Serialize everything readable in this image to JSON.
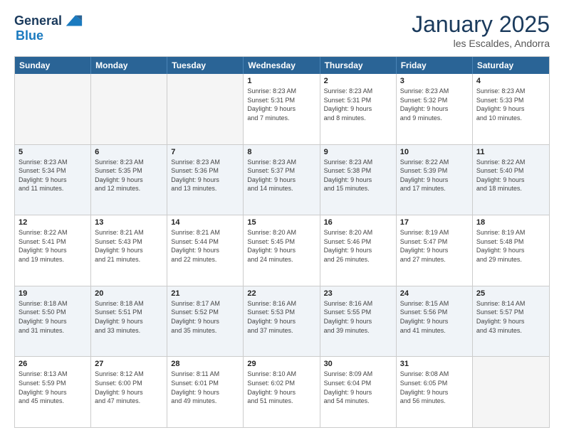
{
  "header": {
    "logo_line1": "General",
    "logo_line2": "Blue",
    "title": "January 2025",
    "subtitle": "les Escaldes, Andorra"
  },
  "weekdays": [
    "Sunday",
    "Monday",
    "Tuesday",
    "Wednesday",
    "Thursday",
    "Friday",
    "Saturday"
  ],
  "rows": [
    [
      {
        "day": "",
        "text": ""
      },
      {
        "day": "",
        "text": ""
      },
      {
        "day": "",
        "text": ""
      },
      {
        "day": "1",
        "text": "Sunrise: 8:23 AM\nSunset: 5:31 PM\nDaylight: 9 hours\nand 7 minutes."
      },
      {
        "day": "2",
        "text": "Sunrise: 8:23 AM\nSunset: 5:31 PM\nDaylight: 9 hours\nand 8 minutes."
      },
      {
        "day": "3",
        "text": "Sunrise: 8:23 AM\nSunset: 5:32 PM\nDaylight: 9 hours\nand 9 minutes."
      },
      {
        "day": "4",
        "text": "Sunrise: 8:23 AM\nSunset: 5:33 PM\nDaylight: 9 hours\nand 10 minutes."
      }
    ],
    [
      {
        "day": "5",
        "text": "Sunrise: 8:23 AM\nSunset: 5:34 PM\nDaylight: 9 hours\nand 11 minutes."
      },
      {
        "day": "6",
        "text": "Sunrise: 8:23 AM\nSunset: 5:35 PM\nDaylight: 9 hours\nand 12 minutes."
      },
      {
        "day": "7",
        "text": "Sunrise: 8:23 AM\nSunset: 5:36 PM\nDaylight: 9 hours\nand 13 minutes."
      },
      {
        "day": "8",
        "text": "Sunrise: 8:23 AM\nSunset: 5:37 PM\nDaylight: 9 hours\nand 14 minutes."
      },
      {
        "day": "9",
        "text": "Sunrise: 8:23 AM\nSunset: 5:38 PM\nDaylight: 9 hours\nand 15 minutes."
      },
      {
        "day": "10",
        "text": "Sunrise: 8:22 AM\nSunset: 5:39 PM\nDaylight: 9 hours\nand 17 minutes."
      },
      {
        "day": "11",
        "text": "Sunrise: 8:22 AM\nSunset: 5:40 PM\nDaylight: 9 hours\nand 18 minutes."
      }
    ],
    [
      {
        "day": "12",
        "text": "Sunrise: 8:22 AM\nSunset: 5:41 PM\nDaylight: 9 hours\nand 19 minutes."
      },
      {
        "day": "13",
        "text": "Sunrise: 8:21 AM\nSunset: 5:43 PM\nDaylight: 9 hours\nand 21 minutes."
      },
      {
        "day": "14",
        "text": "Sunrise: 8:21 AM\nSunset: 5:44 PM\nDaylight: 9 hours\nand 22 minutes."
      },
      {
        "day": "15",
        "text": "Sunrise: 8:20 AM\nSunset: 5:45 PM\nDaylight: 9 hours\nand 24 minutes."
      },
      {
        "day": "16",
        "text": "Sunrise: 8:20 AM\nSunset: 5:46 PM\nDaylight: 9 hours\nand 26 minutes."
      },
      {
        "day": "17",
        "text": "Sunrise: 8:19 AM\nSunset: 5:47 PM\nDaylight: 9 hours\nand 27 minutes."
      },
      {
        "day": "18",
        "text": "Sunrise: 8:19 AM\nSunset: 5:48 PM\nDaylight: 9 hours\nand 29 minutes."
      }
    ],
    [
      {
        "day": "19",
        "text": "Sunrise: 8:18 AM\nSunset: 5:50 PM\nDaylight: 9 hours\nand 31 minutes."
      },
      {
        "day": "20",
        "text": "Sunrise: 8:18 AM\nSunset: 5:51 PM\nDaylight: 9 hours\nand 33 minutes."
      },
      {
        "day": "21",
        "text": "Sunrise: 8:17 AM\nSunset: 5:52 PM\nDaylight: 9 hours\nand 35 minutes."
      },
      {
        "day": "22",
        "text": "Sunrise: 8:16 AM\nSunset: 5:53 PM\nDaylight: 9 hours\nand 37 minutes."
      },
      {
        "day": "23",
        "text": "Sunrise: 8:16 AM\nSunset: 5:55 PM\nDaylight: 9 hours\nand 39 minutes."
      },
      {
        "day": "24",
        "text": "Sunrise: 8:15 AM\nSunset: 5:56 PM\nDaylight: 9 hours\nand 41 minutes."
      },
      {
        "day": "25",
        "text": "Sunrise: 8:14 AM\nSunset: 5:57 PM\nDaylight: 9 hours\nand 43 minutes."
      }
    ],
    [
      {
        "day": "26",
        "text": "Sunrise: 8:13 AM\nSunset: 5:59 PM\nDaylight: 9 hours\nand 45 minutes."
      },
      {
        "day": "27",
        "text": "Sunrise: 8:12 AM\nSunset: 6:00 PM\nDaylight: 9 hours\nand 47 minutes."
      },
      {
        "day": "28",
        "text": "Sunrise: 8:11 AM\nSunset: 6:01 PM\nDaylight: 9 hours\nand 49 minutes."
      },
      {
        "day": "29",
        "text": "Sunrise: 8:10 AM\nSunset: 6:02 PM\nDaylight: 9 hours\nand 51 minutes."
      },
      {
        "day": "30",
        "text": "Sunrise: 8:09 AM\nSunset: 6:04 PM\nDaylight: 9 hours\nand 54 minutes."
      },
      {
        "day": "31",
        "text": "Sunrise: 8:08 AM\nSunset: 6:05 PM\nDaylight: 9 hours\nand 56 minutes."
      },
      {
        "day": "",
        "text": ""
      }
    ]
  ]
}
